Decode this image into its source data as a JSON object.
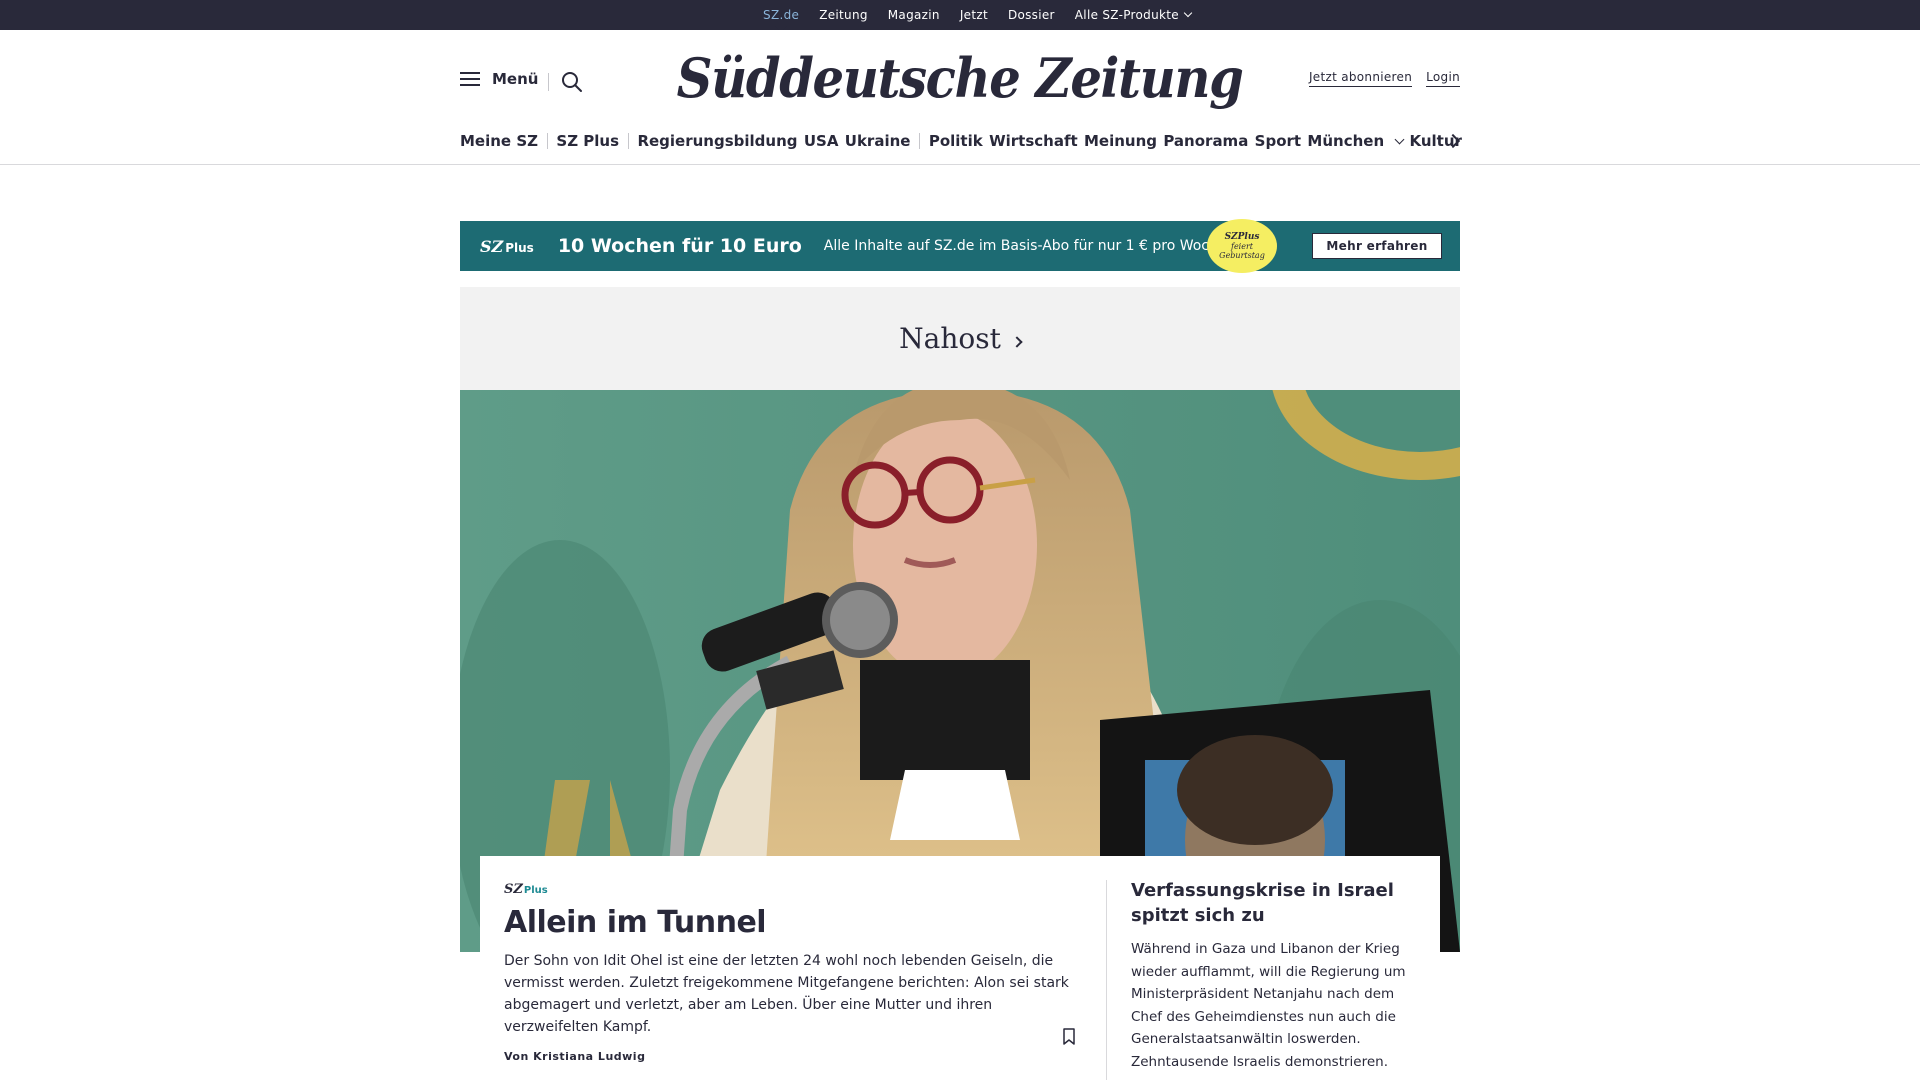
{
  "topbar": {
    "links": [
      "SZ.de",
      "Zeitung",
      "Magazin",
      "Jetzt",
      "Dossier"
    ],
    "products_label": "Alle SZ-Produkte"
  },
  "header": {
    "menu_label": "Menü",
    "logo": "Süddeutsche Zeitung",
    "subscribe_label": "Jetzt abonnieren",
    "login_label": "Login"
  },
  "nav": {
    "items": [
      "Meine SZ",
      "SZ Plus",
      "Regierungsbildung",
      "USA",
      "Ukraine",
      "Politik",
      "Wirtschaft",
      "Meinung",
      "Panorama",
      "Sport",
      "München",
      "Kultur"
    ]
  },
  "promo": {
    "brand": "SZ",
    "brand_suffix": "Plus",
    "headline": "10 Wochen für 10 Euro",
    "text": "Alle Inhalte auf SZ.de im Basis-Abo für nur 1 € pro Woche.",
    "badge_brand": "SZPlus",
    "badge_line1": "feiert",
    "badge_line2": "Geburtstag",
    "button_label": "Mehr erfahren"
  },
  "section": {
    "title": "Nahost"
  },
  "article": {
    "tag_brand": "SZ",
    "tag_suffix": "Plus",
    "headline": "Allein im Tunnel",
    "teaser": "Der Sohn von Idit Ohel ist eine der letzten 24 wohl noch lebenden Geiseln, die vermisst werden. Zuletzt freigekommene Mitgefangene berichten: Alon sei stark abgemagert und verletzt, aber am Leben. Über eine Mutter und ihren verzweifelten Kampf.",
    "byline": "Von Kristiana Ludwig"
  },
  "side_article": {
    "headline": "Verfassungskrise in Israel spitzt sich zu",
    "teaser": "Während in Gaza und Libanon der Krieg wieder aufflammt, will die Regierung um Ministerpräsident Netanjahu nach dem Chef des Geheimdienstes nun auch die Generalstaatsanwältin loswerden. Zehntausende Israelis demonstrieren."
  },
  "colors": {
    "topbar_bg": "#29293a",
    "promo_bg": "#1d6b73",
    "badge_bg": "#f5ee62",
    "section_bg": "#f2f2f2",
    "hero_bg": "#5e9a86"
  }
}
